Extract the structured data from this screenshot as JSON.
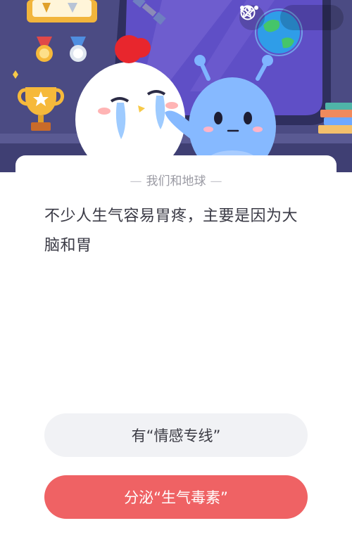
{
  "header": {
    "favorite_icon": "star-outline-icon",
    "more_icon": "more-dots-icon",
    "close_icon": "close-circle-icon"
  },
  "quiz": {
    "category": "我们和地球",
    "question": "不少人生气容易胃疼，主要是因为大脑和胃",
    "options": [
      {
        "label": "有“情感专线”"
      },
      {
        "label": "分泌“生气毒素”"
      }
    ]
  },
  "colors": {
    "scene_bg": "#4b4b83",
    "option_a_bg": "#f1f2f5",
    "option_b_bg": "#ef6264"
  }
}
